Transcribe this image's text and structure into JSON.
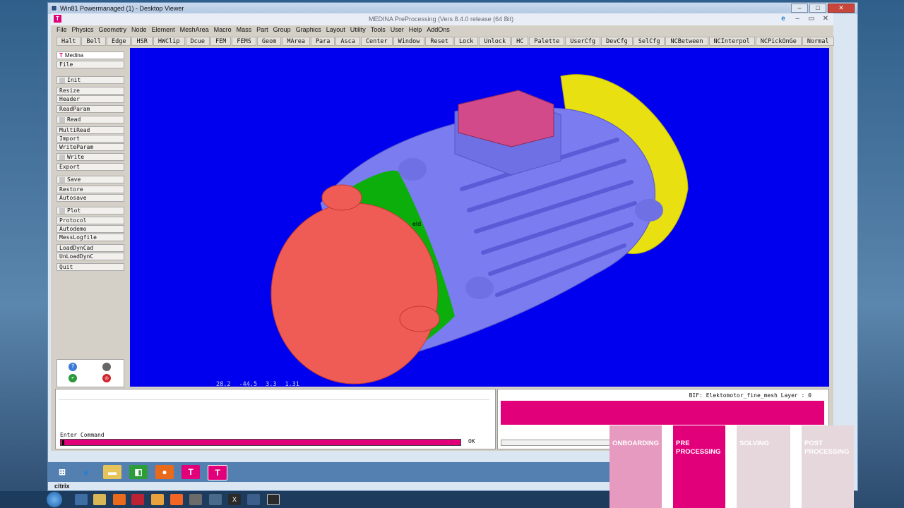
{
  "outer_window": {
    "title": "Win81 Powermanaged (1) - Desktop Viewer",
    "min": "–",
    "max": "□",
    "close": "✕"
  },
  "app": {
    "title": "MEDINA PreProcessing (Vers 8.4.0 release (64 Bit)",
    "logo": "T",
    "menu": [
      "File",
      "Physics",
      "Geometry",
      "Node",
      "Element",
      "MeshArea",
      "Macro",
      "Mass",
      "Part",
      "Group",
      "Graphics",
      "Layout",
      "Utility",
      "Tools",
      "User",
      "Help",
      "AddOns"
    ],
    "toolbar": [
      "Halt",
      "Bell",
      "Edge",
      "HSR",
      "HWClip",
      "Dcue",
      "FEM",
      "FEMS",
      "Geom",
      "MArea",
      "Para",
      "Asca",
      "Center",
      "Window",
      "Reset",
      "Lock",
      "Unlock",
      "HC",
      "Palette",
      "UserCfg",
      "DevCfg",
      "SelCfg",
      "NCBetween",
      "NCInterpol",
      "NCPickOnGe",
      "Normal"
    ]
  },
  "left_panel": {
    "header": "Medina",
    "items": [
      "File",
      "Init",
      "Resize",
      "Header",
      "ReadParam",
      "Read",
      "MultiRead",
      "Import",
      "WriteParam",
      "Write",
      "Export",
      "Save",
      "Restore",
      "Autosave",
      "Plot",
      "Protocol",
      "Autodemo",
      "MessLogfile",
      "LoadDynCad",
      "UnLoadDynC",
      "Quit"
    ]
  },
  "viewport": {
    "coords": [
      "28.2",
      "-44.5",
      "3.3",
      "1.31"
    ],
    "label": "eld",
    "colors": {
      "background": "#0000ee",
      "body": "#7b7cf0",
      "cap": "#ef5c55",
      "ring_green": "#0cae0c",
      "ring_yellow": "#e8e010",
      "box": "#d24a8a"
    }
  },
  "command": {
    "label": "Enter Command",
    "ok": "OK"
  },
  "info": {
    "text": "BIF: Elektomotor_fine_mesh   Layer : 0"
  },
  "steps": [
    {
      "label": "ONBOARDING",
      "color": "#e79ac0"
    },
    {
      "label": "PRE\nPROCESSING",
      "color": "#e2007a"
    },
    {
      "label": "SOLVING",
      "color": "#e5d7db"
    },
    {
      "label": "POST\nPROCESSING",
      "color": "#e5d7db"
    }
  ],
  "citrix": {
    "label": "citrix"
  }
}
